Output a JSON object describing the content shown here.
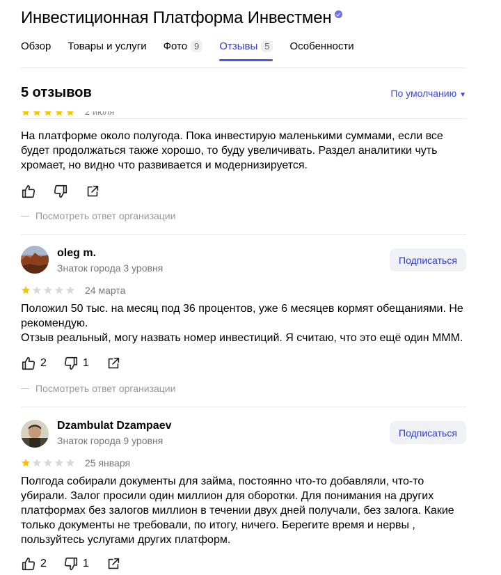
{
  "header": {
    "title": "Инвестиционная Платформа Инвестмен",
    "verified_icon": "verified-badge-icon"
  },
  "tabs": [
    {
      "label": "Обзор",
      "count": null,
      "active": false
    },
    {
      "label": "Товары и услуги",
      "count": null,
      "active": false
    },
    {
      "label": "Фото",
      "count": "9",
      "active": false
    },
    {
      "label": "Отзывы",
      "count": "5",
      "active": true
    },
    {
      "label": "Особенности",
      "count": null,
      "active": false
    }
  ],
  "reviews_section": {
    "heading": "5 отзывов",
    "sort_label": "По умолчанию"
  },
  "reviews": [
    {
      "author": "",
      "level": "",
      "rating": 5,
      "date": "2 июля",
      "text": "На платформе около полугода. Пока инвестирую маленькими суммами, если все будет продолжаться также хорошо, то буду увеличивать. Раздел аналитики чуть хромает, но видно что развивается и модернизируется.",
      "likes": "",
      "dislikes": "",
      "org_reply": "Посмотреть ответ организации"
    },
    {
      "author": "oleg m.",
      "level": "Знаток города 3 уровня",
      "subscribe": "Подписаться",
      "rating": 1,
      "date": "24 марта",
      "text": "Положил 50 тыс. на месяц под 36 процентов, уже 6 месяцев кормят обещаниями. Не рекомендую.\nОтзыв реальный, могу назвать номер инвестиций. Я считаю, что это ещё один МММ.",
      "likes": "2",
      "dislikes": "1",
      "org_reply": "Посмотреть ответ организации"
    },
    {
      "author": "Dzambulat Dzampaev",
      "level": "Знаток города 9 уровня",
      "subscribe": "Подписаться",
      "rating": 1,
      "date": "25 января",
      "text": "Полгода собирали документы для займа, постоянно что-то добавляли, что-то убирали. Залог просили один миллион для оборотки. Для понимания на других платформах без залогов миллион в течении двух дней получали, без залога. Какие только документы не требовали, по итогу, ничего. Берегите время и нервы , пользуйтесь услугами других платформ.",
      "likes": "2",
      "dislikes": "1"
    }
  ],
  "colors": {
    "accent": "#4b56e6",
    "star_filled": "#fcc200",
    "star_empty": "#d9d9d9"
  }
}
